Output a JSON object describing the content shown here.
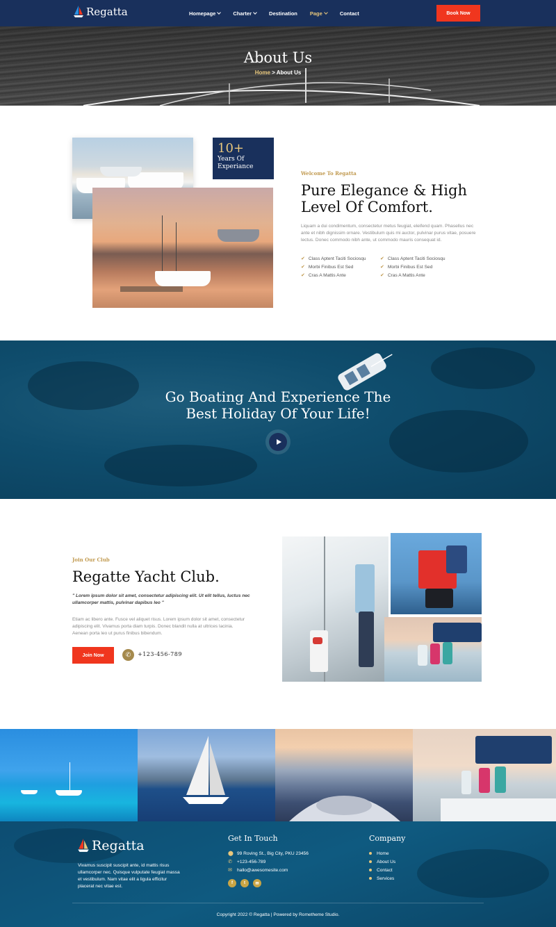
{
  "brand": {
    "name": "Regatta",
    "accent": "#f0361e",
    "navy": "#19305c",
    "gold": "#c19a50"
  },
  "nav": {
    "items": [
      {
        "label": "Homepage",
        "dropdown": true
      },
      {
        "label": "Charter",
        "dropdown": true
      },
      {
        "label": "Destination",
        "dropdown": false
      },
      {
        "label": "Page",
        "dropdown": true,
        "active": true
      },
      {
        "label": "Contact",
        "dropdown": false
      }
    ],
    "cta": "Book Now"
  },
  "hero": {
    "title": "About Us",
    "breadcrumb_home": "Home",
    "breadcrumb_sep": " > ",
    "breadcrumb_current": "About Us"
  },
  "about": {
    "experience_number": "10+",
    "experience_label": "Years Of Experiance",
    "eyebrow": "Welcome To Regatta",
    "title": "Pure Elegance & High Level Of Comfort.",
    "text": "Liquam a dui condimentum, consectetur metus feugiat, eleifend quam. Phasellus nec ante et nibh dignissim ornare. Vestibulum quis mi auctor, pulvinar purus vitae, posuere lectus. Donec commodo nibh ante, ut commodo mauris consequat id.",
    "features_left": [
      "Class Aptent Taciti Sociosqu",
      "Morbi Finibus Est Sed",
      "Cras A Mattis Ante"
    ],
    "features_right": [
      "Class Aptent Taciti Sociosqu",
      "Morbi Finibus Est Sed",
      "Cras A Mattis Ante"
    ]
  },
  "banner": {
    "title_line1": "Go Boating And Experience The",
    "title_line2": "Best Holiday Of Your Life!"
  },
  "club": {
    "eyebrow": "Join Our Club",
    "title": "Regatte Yacht Club.",
    "quote": "\" Lorem ipsum dolor sit amet, consectetur adipiscing elit. Ut elit tellus, luctus nec ullamcorper mattis, pulvinar dapibus leo \"",
    "text": "Etiam ac libero ante. Fusce vel aliquet risus. Lorem ipsum dolor sit amet, consectetur adipiscing elit. Vivamus porta diam turpis. Donec blandit nulla at ultrices lacinia. Aenean porta leo ut purus finibus bibendum.",
    "cta": "Join Now",
    "phone": "+123-456-789"
  },
  "footer": {
    "about": "Vivamus suscipit suscipit ante, id mattis risus ullamcorper nec. Quisque vulputate feugiat massa et vestibulum. Nam vitae elit a ligula efficitur placerat nec vitae est.",
    "contact_heading": "Get In Touch",
    "address": "99 Roving St., Big City, PKU 23456",
    "phone": "+123-456-789",
    "email": "hallo@awesomesite.com",
    "company_heading": "Company",
    "company_links": [
      "Home",
      "About Us",
      "Contact",
      "Services"
    ],
    "copyright": "Copyright 2022 © Regatta | Powered by Rometheme Studio."
  }
}
